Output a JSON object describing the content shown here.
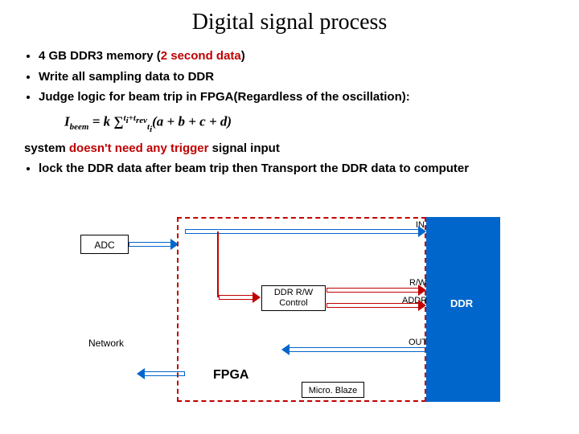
{
  "title": "Digital signal process",
  "bullets": {
    "b1a": "4 GB DDR3 memory (",
    "b1b": "2 second data",
    "b1c": ")",
    "b2": "Write all  sampling data to DDR",
    "b3": "Judge logic for beam trip in FPGA(Regardless of the oscillation):",
    "b4a": "system ",
    "b4b": "doesn't need any trigger",
    "b4c": " signal input",
    "b5": "lock the DDR data after beam trip then Transport the DDR data to computer"
  },
  "formula": {
    "lhs": "I",
    "lhs_sub": "beem",
    "eq": " = k ∑",
    "sum_lo1": "t",
    "sum_lo2": "i",
    "sum_hi1": "t",
    "sum_hi2": "i",
    "sum_hi3": "+t",
    "sum_hi4": "rev",
    "rhs": "(a + b + c + d)"
  },
  "diagram": {
    "adc": "ADC",
    "ctrl1": "DDR R/W",
    "ctrl2": "Control",
    "network": "Network",
    "fpga": "FPGA",
    "mb": "Micro. Blaze",
    "ddr": "DDR",
    "in": "IN",
    "rw": "R/W",
    "addr": "ADDR",
    "out": "OUT"
  }
}
